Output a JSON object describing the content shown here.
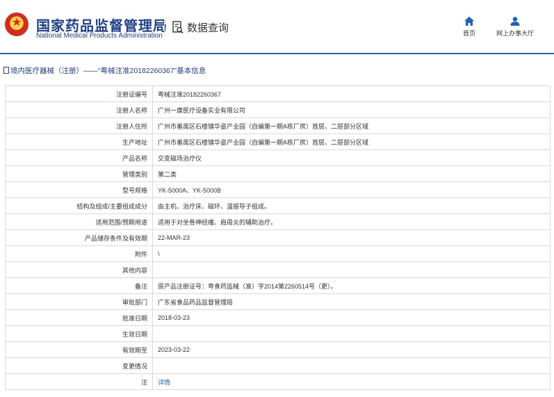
{
  "header": {
    "org_cn": "国家药品监督管理局",
    "org_en": "National Medical Products Administration",
    "query_label": "数据查询",
    "nav": [
      {
        "label": "首页",
        "icon": "home-icon"
      },
      {
        "label": "网上办事大厅",
        "icon": "user-icon"
      }
    ],
    "accent_color": "#1f62b6"
  },
  "breadcrumb": {
    "text": "境内医疗器械（注册）——“粤械注准20182260367”基本信息"
  },
  "table": {
    "rows": [
      {
        "key": "注册证编号",
        "value": "粤械注准20182260367"
      },
      {
        "key": "注册人名称",
        "value": "广州一康医疗设备实业有限公司"
      },
      {
        "key": "注册人住所",
        "value": "广州市番禺区石楼镇华姿产业园（自编第一期A栋厂房）首层、二层部分区域"
      },
      {
        "key": "生产地址",
        "value": "广州市番禺区石楼镇华姿产业园（自编第一期A栋厂房）首层、二层部分区域"
      },
      {
        "key": "产品名称",
        "value": "交变磁场治疗仪"
      },
      {
        "key": "管理类别",
        "value": "第二类"
      },
      {
        "key": "型号规格",
        "value": "YK-5000A、YK-5000B"
      },
      {
        "key": "结构及组成/主要组成成分",
        "value": "由主机、治疗床、磁环、温振导子组成。"
      },
      {
        "key": "适用范围/预期用途",
        "value": "适用于对坐骨神经痛、肩周炎的辅助治疗。"
      },
      {
        "key": "产品储存条件及有效期",
        "value": "22-MAR-23"
      },
      {
        "key": "附件",
        "value": "\\"
      },
      {
        "key": "其他内容",
        "value": ""
      },
      {
        "key": "备注",
        "value": "原产品注册证号：粤食药监械（准）字2014第2260514号（更）。"
      },
      {
        "key": "审批部门",
        "value": "广东省食品药品监督管理局"
      },
      {
        "key": "批准日期",
        "value": "2018-03-23"
      },
      {
        "key": "生效日期",
        "value": ""
      },
      {
        "key": "有效期至",
        "value": "2023-03-22"
      },
      {
        "key": "变更情况",
        "value": ""
      },
      {
        "key": "注",
        "value": "详情"
      }
    ]
  }
}
